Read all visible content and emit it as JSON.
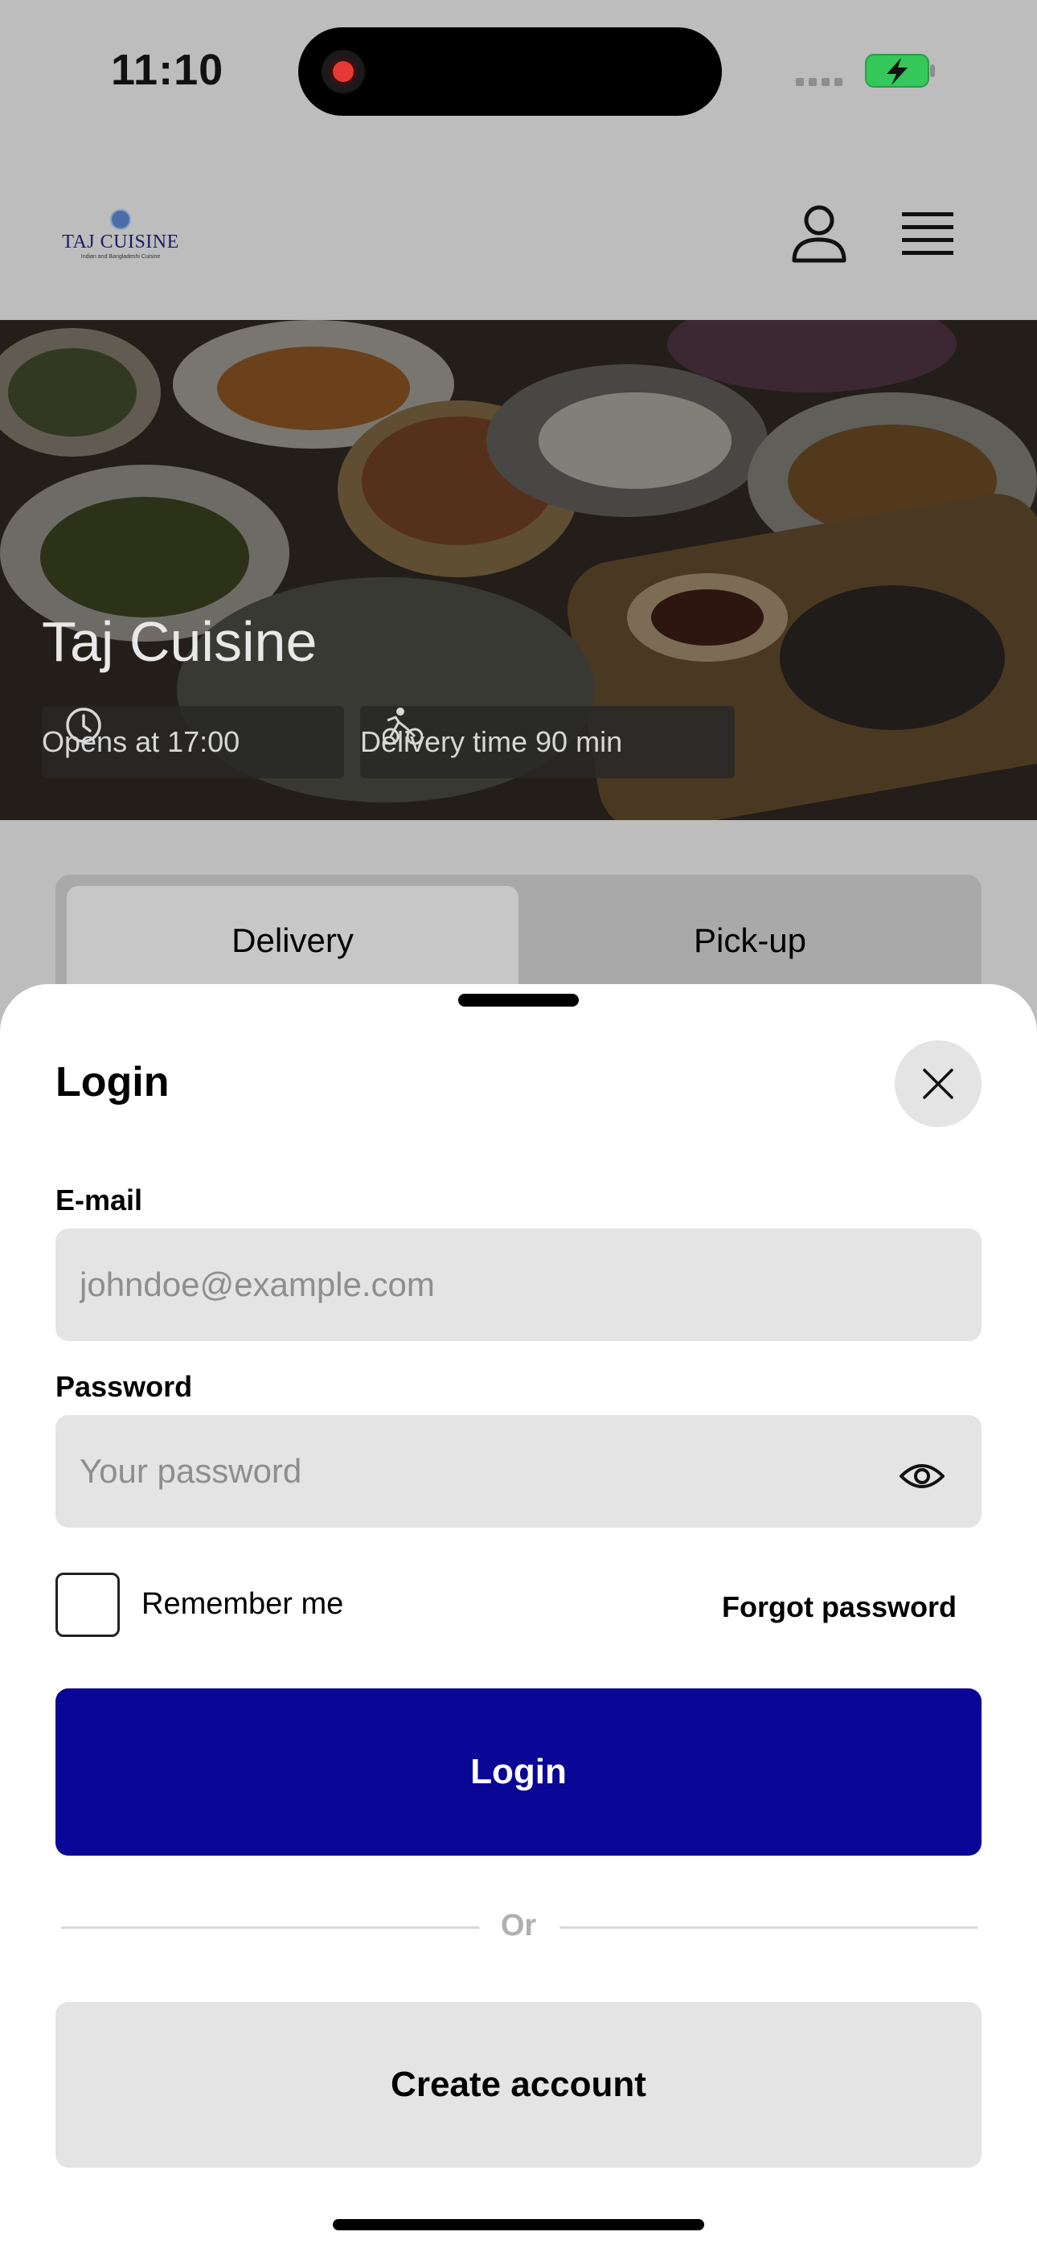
{
  "status_bar": {
    "time": "11:10",
    "icons": [
      "screen-recording-icon",
      "cellular-signal-icon",
      "battery-charging-icon"
    ],
    "battery_color": "#34c759"
  },
  "header": {
    "logo": {
      "title": "TAJ CUISINE",
      "subtitle": "Indian and Bangladeshi Cuisine"
    },
    "icons": [
      "user-icon",
      "menu-icon"
    ]
  },
  "hero": {
    "restaurant_name": "Taj Cuisine",
    "opens_label": "Opens at 17:00",
    "delivery_label": "Delivery time 90 min"
  },
  "order_type": {
    "options": [
      "Delivery",
      "Pick-up"
    ],
    "selected": "Delivery"
  },
  "login_sheet": {
    "title": "Login",
    "email_label": "E-mail",
    "email_placeholder": "johndoe@example.com",
    "email_value": "",
    "password_label": "Password",
    "password_placeholder": "Your password",
    "password_value": "",
    "remember_label": "Remember me",
    "remember_checked": false,
    "forgot_label": "Forgot password",
    "login_button": "Login",
    "divider_text": "Or",
    "create_account_button": "Create account"
  },
  "colors": {
    "primary": "#0a0796",
    "overlay_background": "#bdbdbd",
    "field_background": "#e4e4e4"
  }
}
